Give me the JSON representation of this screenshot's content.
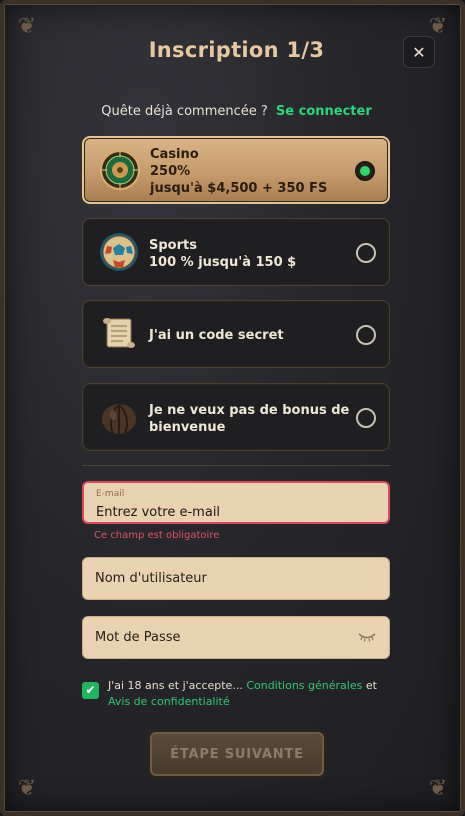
{
  "header": {
    "title": "Inscription 1/3",
    "close_label": "✕"
  },
  "login": {
    "prompt": "Quête déjà commencée ?",
    "link": "Se connecter"
  },
  "options": [
    {
      "line1": "Casino",
      "line2": "250%",
      "line3": "jusqu'à $4,500 + 350 FS",
      "icon": "roulette-icon",
      "selected": true
    },
    {
      "line1": "Sports",
      "line2": "100 % jusqu'à 150 $",
      "icon": "soccer-ball-icon",
      "selected": false
    },
    {
      "line1": "J'ai un code secret",
      "icon": "scroll-icon",
      "selected": false
    },
    {
      "line1": "Je ne veux pas de bonus de",
      "line2": "bienvenue",
      "icon": "chestnut-icon",
      "selected": false
    }
  ],
  "form": {
    "email": {
      "label": "E-mail",
      "value": "Entrez votre e-mail",
      "error": "Ce champ est obligatoire"
    },
    "username": {
      "placeholder": "Nom d'utilisateur"
    },
    "password": {
      "placeholder": "Mot de Passe"
    }
  },
  "agreement": {
    "checked": true,
    "text": "J'ai 18 ans et j'accepte...",
    "terms_link": "Conditions générales",
    "and": "et",
    "privacy_link": "Avis de confidentialité"
  },
  "next_button": {
    "label": "ÉTAPE SUIVANTE"
  },
  "colors": {
    "accent_green": "#2fd47c",
    "error": "#e0506a",
    "gold": "#e6c9a0"
  }
}
